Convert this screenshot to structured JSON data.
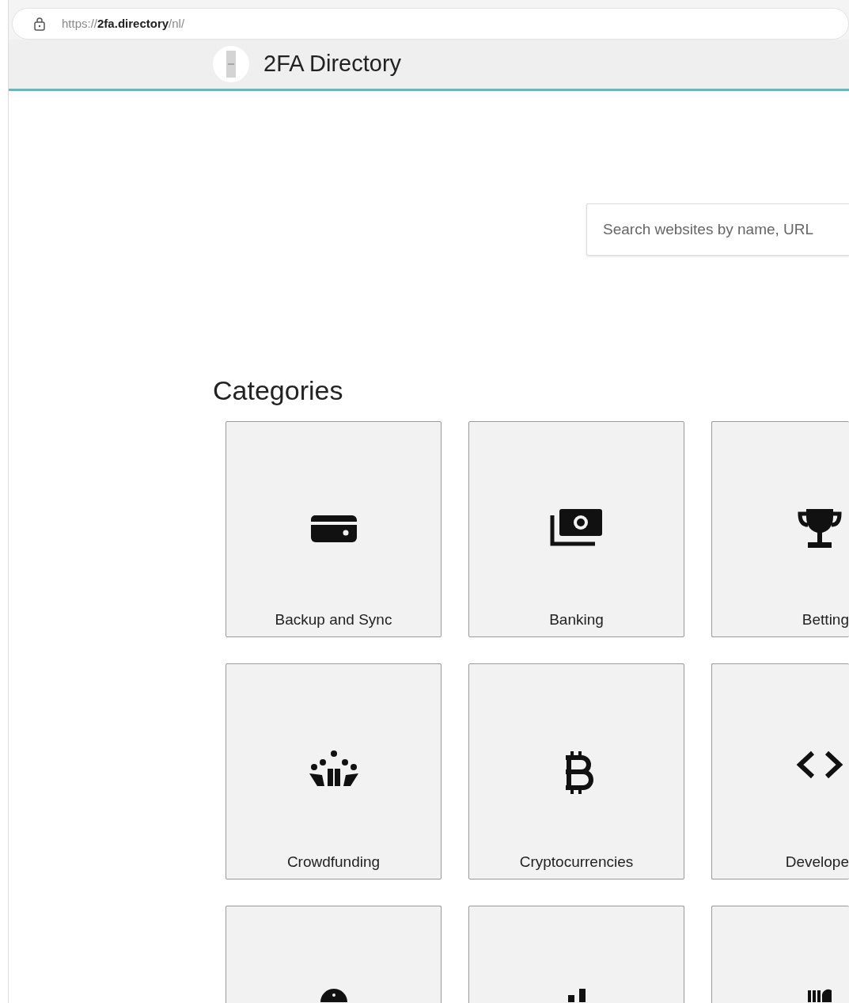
{
  "browser": {
    "url": "https://**2fa.directory**/nl/"
  },
  "header": {
    "title": "2FA Directory"
  },
  "search": {
    "placeholder": "Search websites by name, URL"
  },
  "categories_heading": "Categories",
  "categories": [
    {
      "kind": "category",
      "label": "Backup and Sync"
    },
    {
      "kind": "category",
      "label": "Banking"
    },
    {
      "kind": "category",
      "label": "Betting"
    },
    {
      "kind": "category",
      "label": "Crowdfunding"
    },
    {
      "kind": "category",
      "label": "Cryptocurrencies"
    },
    {
      "kind": "category",
      "label": "Develope"
    },
    {
      "kind": "category"
    },
    {
      "kind": "category"
    },
    {
      "kind": "category"
    }
  ]
}
